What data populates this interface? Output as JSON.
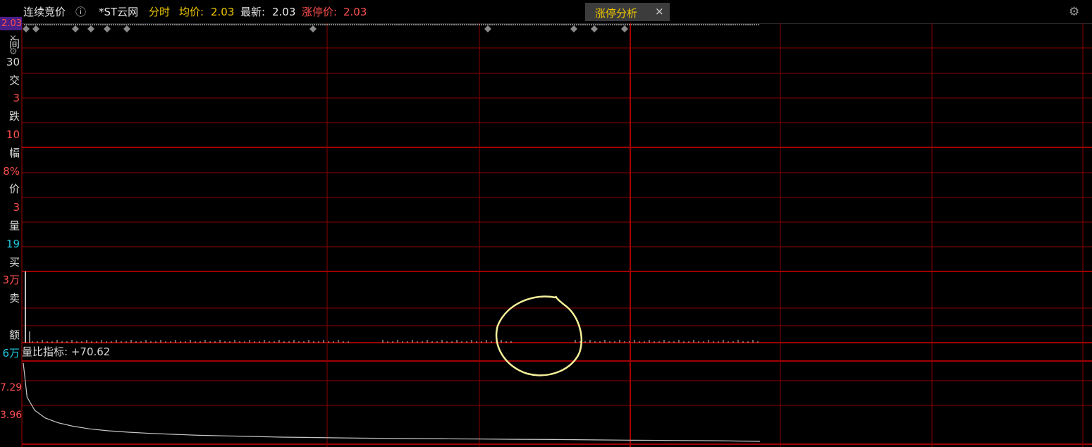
{
  "topbar": {
    "title": "连续竞价",
    "info_icon": "info-icon",
    "stock_name": "*ST云网",
    "mode": "分时",
    "avg_label": "均价:",
    "avg_value": "2.03",
    "latest_label": "最新:",
    "latest_value": "2.03",
    "limit_up_label": "涨停价:",
    "limit_up_value": "2.03",
    "tab_label": "涨停分析",
    "tab_close": "×",
    "settings_icon": "gear-icon"
  },
  "price_scale": {
    "top_value": "2.03"
  },
  "left_panel": {
    "close": "×",
    "rows": [
      {
        "text": "间",
        "color": "#d8d8d8"
      },
      {
        "text": "30",
        "color": "#d8d8d8"
      },
      {
        "text": "交",
        "color": "#d8d8d8"
      },
      {
        "text": "3",
        "color": "#ff4f4f"
      },
      {
        "text": "跌",
        "color": "#d8d8d8"
      },
      {
        "text": "10",
        "color": "#ff4f4f"
      },
      {
        "text": "幅",
        "color": "#d8d8d8"
      },
      {
        "text": "8%",
        "color": "#ff4f4f"
      },
      {
        "text": "价",
        "color": "#d8d8d8"
      },
      {
        "text": "3",
        "color": "#ff4f4f"
      },
      {
        "text": "量",
        "color": "#d8d8d8"
      },
      {
        "text": "19",
        "color": "#22c6e0"
      },
      {
        "text": "买",
        "color": "#d8d8d8"
      },
      {
        "text": "3万",
        "color": "#ff4f4f"
      },
      {
        "text": "卖",
        "color": "#d8d8d8"
      },
      {
        "text": "",
        "color": "#d8d8d8"
      },
      {
        "text": "额",
        "color": "#d8d8d8"
      },
      {
        "text": "6万",
        "color": "#22c6e0"
      }
    ]
  },
  "volume_ratio": {
    "label": "量比指标:",
    "value": "+70.62"
  },
  "ratio_scale": [
    "7.29",
    "3.96"
  ],
  "colors": {
    "grid": "#8a0000",
    "grid_bold": "#a00000",
    "price_line": "#ffffff",
    "ratio_line": "#c8c8c8",
    "annotation": "#f5f09a",
    "up": "#ff4f4f",
    "cyan": "#22c6e0",
    "gold": "#f0c800"
  },
  "chart_data": {
    "type": "line",
    "price_series": {
      "value": 2.03
    },
    "volume_ratio_series": {
      "values": [
        70.62,
        28,
        17,
        12,
        9.5,
        8,
        7,
        6.4,
        6,
        5.7,
        5.5,
        5.3,
        5.2,
        5.1,
        5.0,
        4.95,
        4.9,
        4.86,
        4.83,
        4.8,
        4.78,
        4.76,
        4.74,
        4.72,
        4.7,
        4.69,
        4.68,
        4.67
      ]
    }
  }
}
